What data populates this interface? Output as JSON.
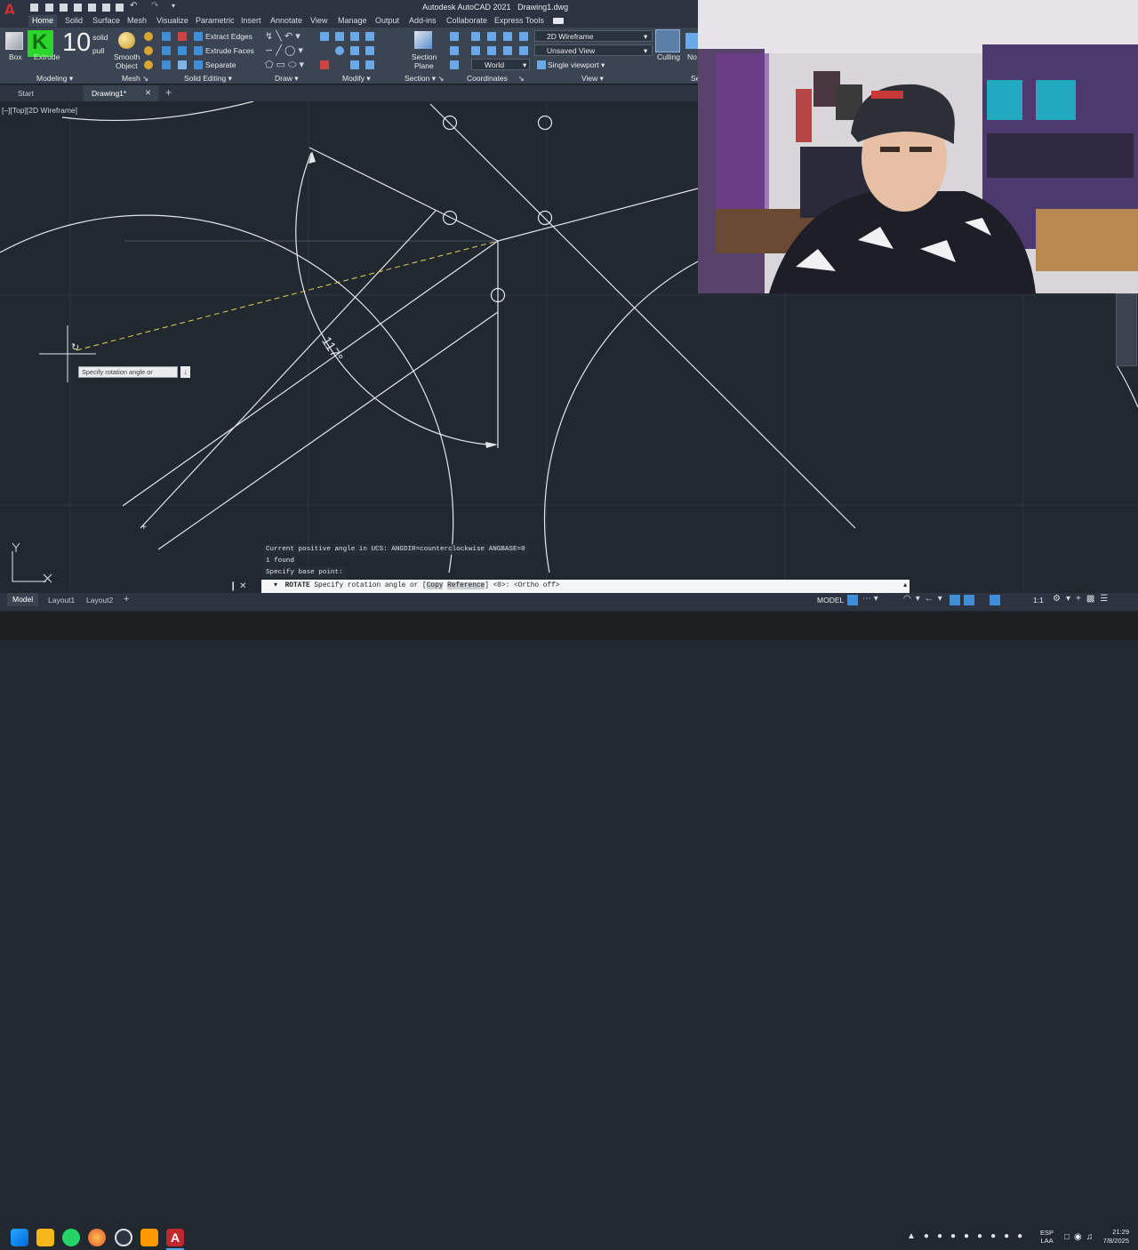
{
  "app": {
    "title": "Autodesk AutoCAD 2021",
    "document": "Drawing1.dwg"
  },
  "ribbon_tabs": [
    "Home",
    "Solid",
    "Surface",
    "Mesh",
    "Visualize",
    "Parametric",
    "Insert",
    "Annotate",
    "View",
    "Manage",
    "Output",
    "Add-ins",
    "Collaborate",
    "Express Tools"
  ],
  "ribbon": {
    "box_label": "Box",
    "extrude_label": "Extrude",
    "presspull_label": "solid",
    "presspull_sub": "pull",
    "overlay_number": "10",
    "smooth_object_l1": "Smooth",
    "smooth_object_l2": "Object",
    "extract_edges": "Extract Edges",
    "extrude_faces": "Extrude Faces",
    "separate": "Separate",
    "section_plane_l1": "Section",
    "section_plane_l2": "Plane",
    "visual_style": "2D Wireframe",
    "named_view": "Unsaved View",
    "ucs": "World",
    "viewport_config": "Single viewport",
    "culling": "Culling",
    "no_filter": "No",
    "groups": {
      "modeling": "Modeling",
      "mesh": "Mesh",
      "solid_editing": "Solid Editing",
      "draw": "Draw",
      "modify": "Modify",
      "section": "Section",
      "coordinates": "Coordinates",
      "view": "View",
      "selection": "Se"
    }
  },
  "file_tabs": {
    "start": "Start",
    "drawing": "Drawing1*"
  },
  "viewport": {
    "label": "[–][Top][2D Wireframe]",
    "angle_label": "117°",
    "tooltip": "Specify rotation angle or",
    "tooltip_key": "↓"
  },
  "command": {
    "history": [
      "Current positive angle in UCS:  ANGDIR=counterclockwise  ANGBASE=0",
      "1 found",
      "Specify base point:"
    ],
    "prompt_cmd": "ROTATE",
    "prompt_text": "Specify rotation angle or [",
    "opt_copy": "Copy",
    "opt_reference": "Reference",
    "prompt_tail": "] <0>:  <Ortho off>"
  },
  "layout_tabs": [
    "Model",
    "Layout1",
    "Layout2"
  ],
  "status": {
    "model": "MODEL",
    "scale": "1:1"
  },
  "taskbar": {
    "lang1": "ESP",
    "lang2": "LAA",
    "time": "21:29",
    "date": "7/8/2025"
  },
  "colors": {
    "accent": "#0078d4",
    "autocad_red": "#c4262e",
    "drawing_bg": "#212830",
    "rubberband": "#e2d45a"
  }
}
